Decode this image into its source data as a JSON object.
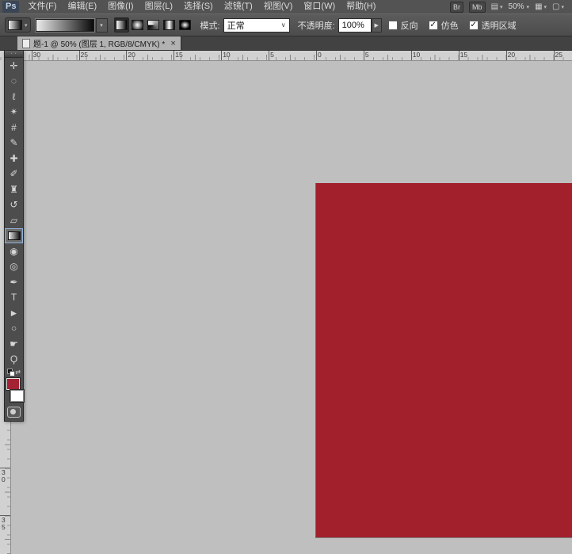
{
  "app": {
    "logo": "Ps"
  },
  "menu": {
    "items": [
      "文件(F)",
      "编辑(E)",
      "图像(I)",
      "图层(L)",
      "选择(S)",
      "滤镜(T)",
      "视图(V)",
      "窗口(W)",
      "帮助(H)"
    ]
  },
  "app_bar": {
    "bridge": "Br",
    "mini_bridge": "Mb",
    "zoom": "50%"
  },
  "options": {
    "mode_label": "模式:",
    "mode_value": "正常",
    "opacity_label": "不透明度:",
    "opacity_value": "100%",
    "checkboxes": [
      {
        "name": "reverse",
        "label": "反向",
        "checked": false
      },
      {
        "name": "dither",
        "label": "仿色",
        "checked": true
      },
      {
        "name": "transparency",
        "label": "透明区域",
        "checked": true
      }
    ],
    "gradient_types": [
      {
        "name": "linear",
        "selected": true
      },
      {
        "name": "radial",
        "selected": false
      },
      {
        "name": "angle",
        "selected": false
      },
      {
        "name": "reflected",
        "selected": false
      },
      {
        "name": "diamond",
        "selected": false
      }
    ]
  },
  "tab": {
    "title": "题-1 @ 50% (图层 1, RGB/8/CMYK) *",
    "close": "×"
  },
  "ruler": {
    "horizontal_labels": [
      "30",
      "25",
      "20",
      "15",
      "10",
      "5",
      "0",
      "5",
      "10",
      "15",
      "20",
      "25"
    ],
    "vertical_labels": [
      "30",
      "35"
    ]
  },
  "toolbox": {
    "tools": [
      {
        "name": "move-tool",
        "glyph": "✛",
        "selected": false
      },
      {
        "name": "elliptical-marquee-tool",
        "glyph": "◌",
        "selected": false
      },
      {
        "name": "lasso-tool",
        "glyph": "ℓ",
        "selected": false
      },
      {
        "name": "quick-selection-tool",
        "glyph": "✴",
        "selected": false
      },
      {
        "name": "crop-tool",
        "glyph": "#",
        "selected": false
      },
      {
        "name": "eyedropper-tool",
        "glyph": "✎",
        "selected": false
      },
      {
        "name": "healing-brush-tool",
        "glyph": "✚",
        "selected": false
      },
      {
        "name": "brush-tool",
        "glyph": "✐",
        "selected": false
      },
      {
        "name": "clone-stamp-tool",
        "glyph": "♜",
        "selected": false
      },
      {
        "name": "history-brush-tool",
        "glyph": "↺",
        "selected": false
      },
      {
        "name": "eraser-tool",
        "glyph": "▱",
        "selected": false
      },
      {
        "name": "gradient-tool",
        "glyph": "",
        "selected": true
      },
      {
        "name": "blur-tool",
        "glyph": "◉",
        "selected": false
      },
      {
        "name": "dodge-tool",
        "glyph": "◎",
        "selected": false
      },
      {
        "name": "pen-tool",
        "glyph": "✒",
        "selected": false
      },
      {
        "name": "type-tool",
        "glyph": "T",
        "selected": false
      },
      {
        "name": "path-selection-tool",
        "glyph": "►",
        "selected": false
      },
      {
        "name": "ellipse-tool",
        "glyph": "○",
        "selected": false
      },
      {
        "name": "hand-tool",
        "glyph": "☛",
        "selected": false
      },
      {
        "name": "zoom-tool",
        "glyph": "Ϙ",
        "selected": false
      }
    ],
    "foreground_color": "#a32233",
    "background_color": "#ffffff"
  },
  "canvas": {
    "background": "#bfbfbf",
    "document_color": "#a21f2c"
  }
}
